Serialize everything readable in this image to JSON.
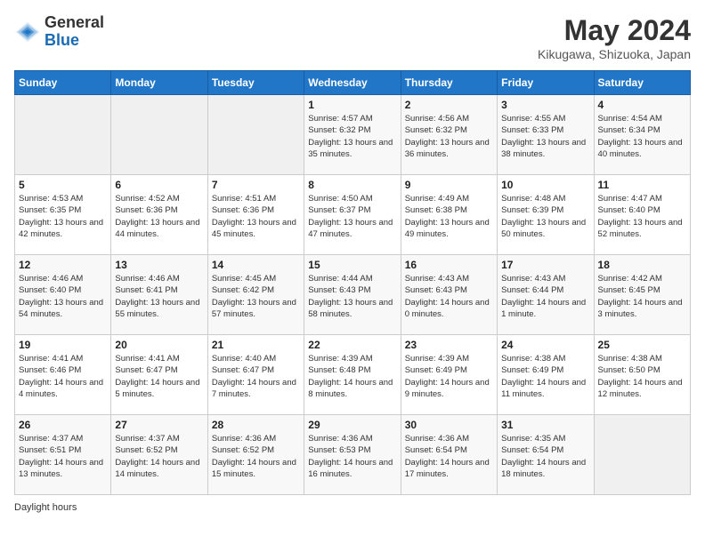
{
  "logo": {
    "general": "General",
    "blue": "Blue"
  },
  "title": "May 2024",
  "location": "Kikugawa, Shizuoka, Japan",
  "days_of_week": [
    "Sunday",
    "Monday",
    "Tuesday",
    "Wednesday",
    "Thursday",
    "Friday",
    "Saturday"
  ],
  "footer_text": "Daylight hours",
  "weeks": [
    [
      {
        "day": "",
        "sunrise": "",
        "sunset": "",
        "daylight": ""
      },
      {
        "day": "",
        "sunrise": "",
        "sunset": "",
        "daylight": ""
      },
      {
        "day": "",
        "sunrise": "",
        "sunset": "",
        "daylight": ""
      },
      {
        "day": "1",
        "sunrise": "Sunrise: 4:57 AM",
        "sunset": "Sunset: 6:32 PM",
        "daylight": "Daylight: 13 hours and 35 minutes."
      },
      {
        "day": "2",
        "sunrise": "Sunrise: 4:56 AM",
        "sunset": "Sunset: 6:32 PM",
        "daylight": "Daylight: 13 hours and 36 minutes."
      },
      {
        "day": "3",
        "sunrise": "Sunrise: 4:55 AM",
        "sunset": "Sunset: 6:33 PM",
        "daylight": "Daylight: 13 hours and 38 minutes."
      },
      {
        "day": "4",
        "sunrise": "Sunrise: 4:54 AM",
        "sunset": "Sunset: 6:34 PM",
        "daylight": "Daylight: 13 hours and 40 minutes."
      }
    ],
    [
      {
        "day": "5",
        "sunrise": "Sunrise: 4:53 AM",
        "sunset": "Sunset: 6:35 PM",
        "daylight": "Daylight: 13 hours and 42 minutes."
      },
      {
        "day": "6",
        "sunrise": "Sunrise: 4:52 AM",
        "sunset": "Sunset: 6:36 PM",
        "daylight": "Daylight: 13 hours and 44 minutes."
      },
      {
        "day": "7",
        "sunrise": "Sunrise: 4:51 AM",
        "sunset": "Sunset: 6:36 PM",
        "daylight": "Daylight: 13 hours and 45 minutes."
      },
      {
        "day": "8",
        "sunrise": "Sunrise: 4:50 AM",
        "sunset": "Sunset: 6:37 PM",
        "daylight": "Daylight: 13 hours and 47 minutes."
      },
      {
        "day": "9",
        "sunrise": "Sunrise: 4:49 AM",
        "sunset": "Sunset: 6:38 PM",
        "daylight": "Daylight: 13 hours and 49 minutes."
      },
      {
        "day": "10",
        "sunrise": "Sunrise: 4:48 AM",
        "sunset": "Sunset: 6:39 PM",
        "daylight": "Daylight: 13 hours and 50 minutes."
      },
      {
        "day": "11",
        "sunrise": "Sunrise: 4:47 AM",
        "sunset": "Sunset: 6:40 PM",
        "daylight": "Daylight: 13 hours and 52 minutes."
      }
    ],
    [
      {
        "day": "12",
        "sunrise": "Sunrise: 4:46 AM",
        "sunset": "Sunset: 6:40 PM",
        "daylight": "Daylight: 13 hours and 54 minutes."
      },
      {
        "day": "13",
        "sunrise": "Sunrise: 4:46 AM",
        "sunset": "Sunset: 6:41 PM",
        "daylight": "Daylight: 13 hours and 55 minutes."
      },
      {
        "day": "14",
        "sunrise": "Sunrise: 4:45 AM",
        "sunset": "Sunset: 6:42 PM",
        "daylight": "Daylight: 13 hours and 57 minutes."
      },
      {
        "day": "15",
        "sunrise": "Sunrise: 4:44 AM",
        "sunset": "Sunset: 6:43 PM",
        "daylight": "Daylight: 13 hours and 58 minutes."
      },
      {
        "day": "16",
        "sunrise": "Sunrise: 4:43 AM",
        "sunset": "Sunset: 6:43 PM",
        "daylight": "Daylight: 14 hours and 0 minutes."
      },
      {
        "day": "17",
        "sunrise": "Sunrise: 4:43 AM",
        "sunset": "Sunset: 6:44 PM",
        "daylight": "Daylight: 14 hours and 1 minute."
      },
      {
        "day": "18",
        "sunrise": "Sunrise: 4:42 AM",
        "sunset": "Sunset: 6:45 PM",
        "daylight": "Daylight: 14 hours and 3 minutes."
      }
    ],
    [
      {
        "day": "19",
        "sunrise": "Sunrise: 4:41 AM",
        "sunset": "Sunset: 6:46 PM",
        "daylight": "Daylight: 14 hours and 4 minutes."
      },
      {
        "day": "20",
        "sunrise": "Sunrise: 4:41 AM",
        "sunset": "Sunset: 6:47 PM",
        "daylight": "Daylight: 14 hours and 5 minutes."
      },
      {
        "day": "21",
        "sunrise": "Sunrise: 4:40 AM",
        "sunset": "Sunset: 6:47 PM",
        "daylight": "Daylight: 14 hours and 7 minutes."
      },
      {
        "day": "22",
        "sunrise": "Sunrise: 4:39 AM",
        "sunset": "Sunset: 6:48 PM",
        "daylight": "Daylight: 14 hours and 8 minutes."
      },
      {
        "day": "23",
        "sunrise": "Sunrise: 4:39 AM",
        "sunset": "Sunset: 6:49 PM",
        "daylight": "Daylight: 14 hours and 9 minutes."
      },
      {
        "day": "24",
        "sunrise": "Sunrise: 4:38 AM",
        "sunset": "Sunset: 6:49 PM",
        "daylight": "Daylight: 14 hours and 11 minutes."
      },
      {
        "day": "25",
        "sunrise": "Sunrise: 4:38 AM",
        "sunset": "Sunset: 6:50 PM",
        "daylight": "Daylight: 14 hours and 12 minutes."
      }
    ],
    [
      {
        "day": "26",
        "sunrise": "Sunrise: 4:37 AM",
        "sunset": "Sunset: 6:51 PM",
        "daylight": "Daylight: 14 hours and 13 minutes."
      },
      {
        "day": "27",
        "sunrise": "Sunrise: 4:37 AM",
        "sunset": "Sunset: 6:52 PM",
        "daylight": "Daylight: 14 hours and 14 minutes."
      },
      {
        "day": "28",
        "sunrise": "Sunrise: 4:36 AM",
        "sunset": "Sunset: 6:52 PM",
        "daylight": "Daylight: 14 hours and 15 minutes."
      },
      {
        "day": "29",
        "sunrise": "Sunrise: 4:36 AM",
        "sunset": "Sunset: 6:53 PM",
        "daylight": "Daylight: 14 hours and 16 minutes."
      },
      {
        "day": "30",
        "sunrise": "Sunrise: 4:36 AM",
        "sunset": "Sunset: 6:54 PM",
        "daylight": "Daylight: 14 hours and 17 minutes."
      },
      {
        "day": "31",
        "sunrise": "Sunrise: 4:35 AM",
        "sunset": "Sunset: 6:54 PM",
        "daylight": "Daylight: 14 hours and 18 minutes."
      },
      {
        "day": "",
        "sunrise": "",
        "sunset": "",
        "daylight": ""
      }
    ]
  ]
}
